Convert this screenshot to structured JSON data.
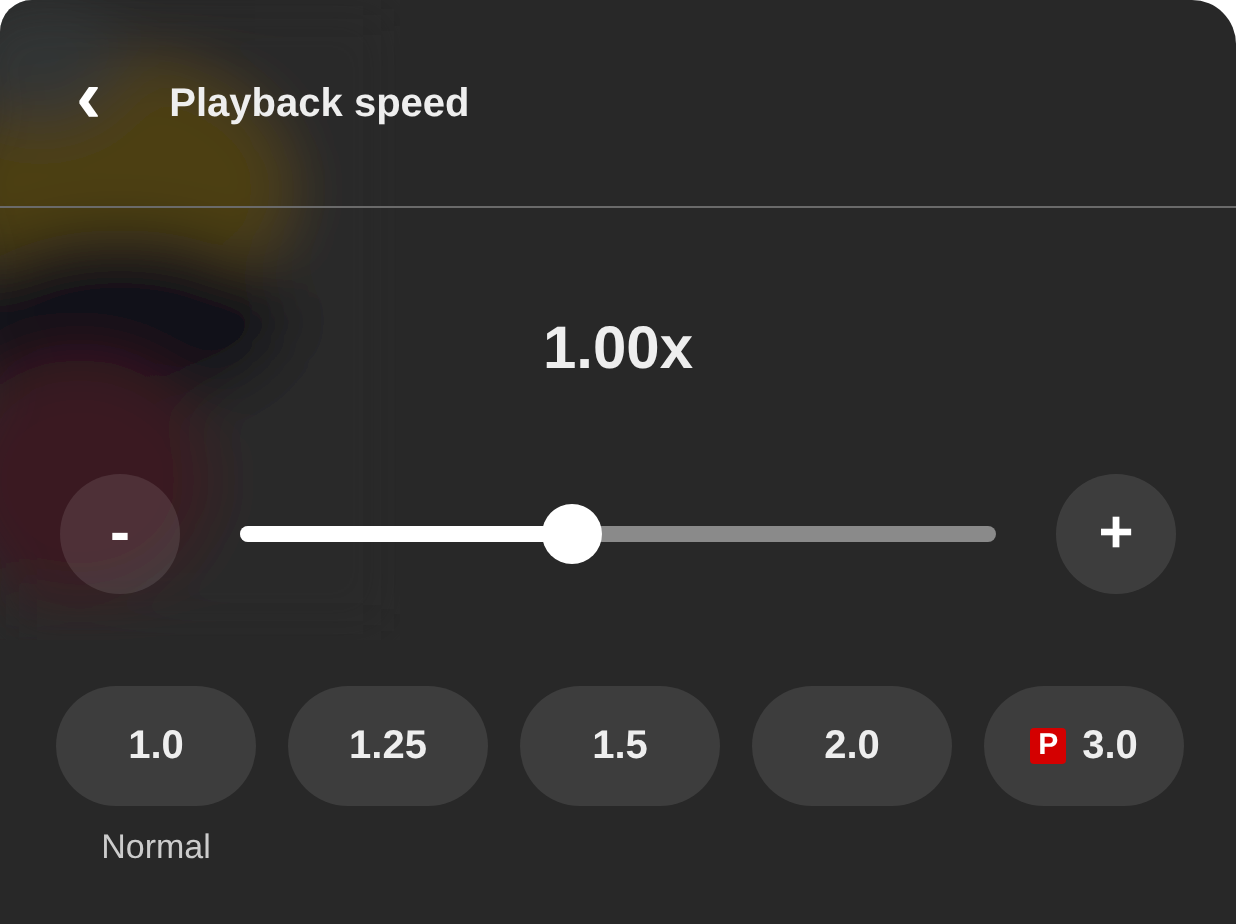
{
  "header": {
    "back": "‹",
    "title": "Playback speed"
  },
  "speed": {
    "reading": "1.00x",
    "minus": "-",
    "plus": "+",
    "level": 0.44
  },
  "presets": [
    {
      "label": "1.0",
      "caption": "Normal"
    },
    {
      "label": "1.25"
    },
    {
      "label": "1.5"
    },
    {
      "label": "2.0"
    },
    {
      "label": "3.0",
      "badge": "P"
    }
  ]
}
